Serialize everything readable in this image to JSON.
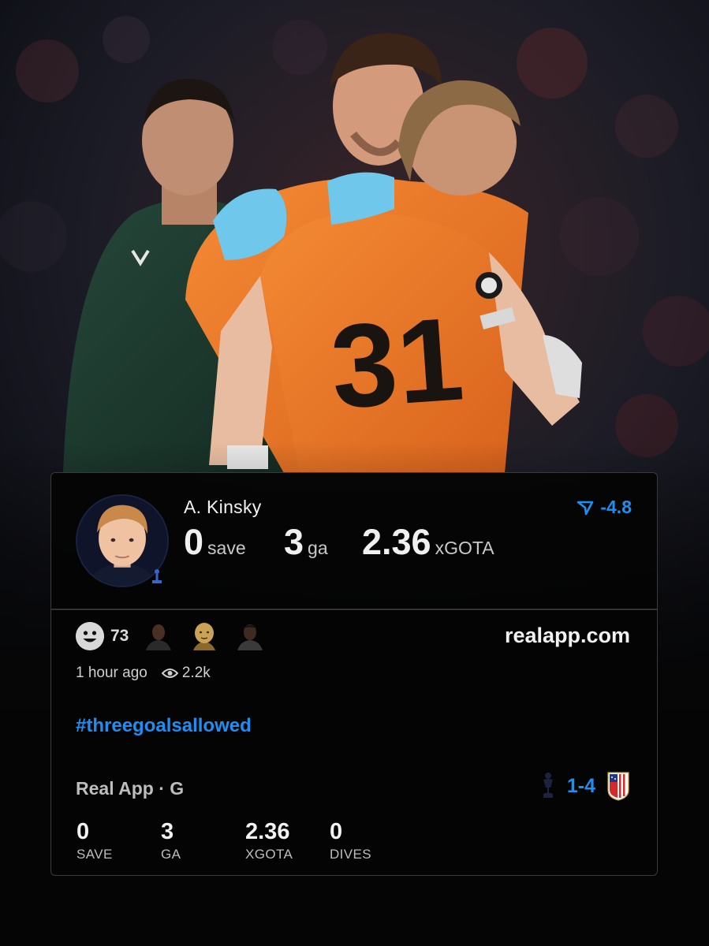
{
  "post": {
    "player_name": "A. Kinsky",
    "headline_stats": [
      {
        "value": "0",
        "label": "save"
      },
      {
        "value": "3",
        "label": "ga"
      },
      {
        "value": "2.36",
        "label": "xGOTA"
      }
    ],
    "delta": "-4.8",
    "reaction_count": "73",
    "site": "realapp.com",
    "time_ago": "1 hour ago",
    "views": "2.2k",
    "hashtag": "#threegoalsallowed",
    "source": "Real App · G",
    "score": "1-4",
    "bottom_stats": [
      {
        "value": "0",
        "label": "SAVE"
      },
      {
        "value": "3",
        "label": "GA"
      },
      {
        "value": "2.36",
        "label": "XGOTA"
      },
      {
        "value": "0",
        "label": "DIVES"
      }
    ]
  },
  "colors": {
    "accent": "#1d8ff2",
    "card_bg": "#040404",
    "keeper_kit": "#ef7f2c",
    "referee_jacket": "#1f3a2a"
  },
  "icons": [
    "trend-down-icon",
    "smile-icon",
    "eye-icon",
    "tottenham-crest-icon",
    "atletico-crest-icon"
  ]
}
